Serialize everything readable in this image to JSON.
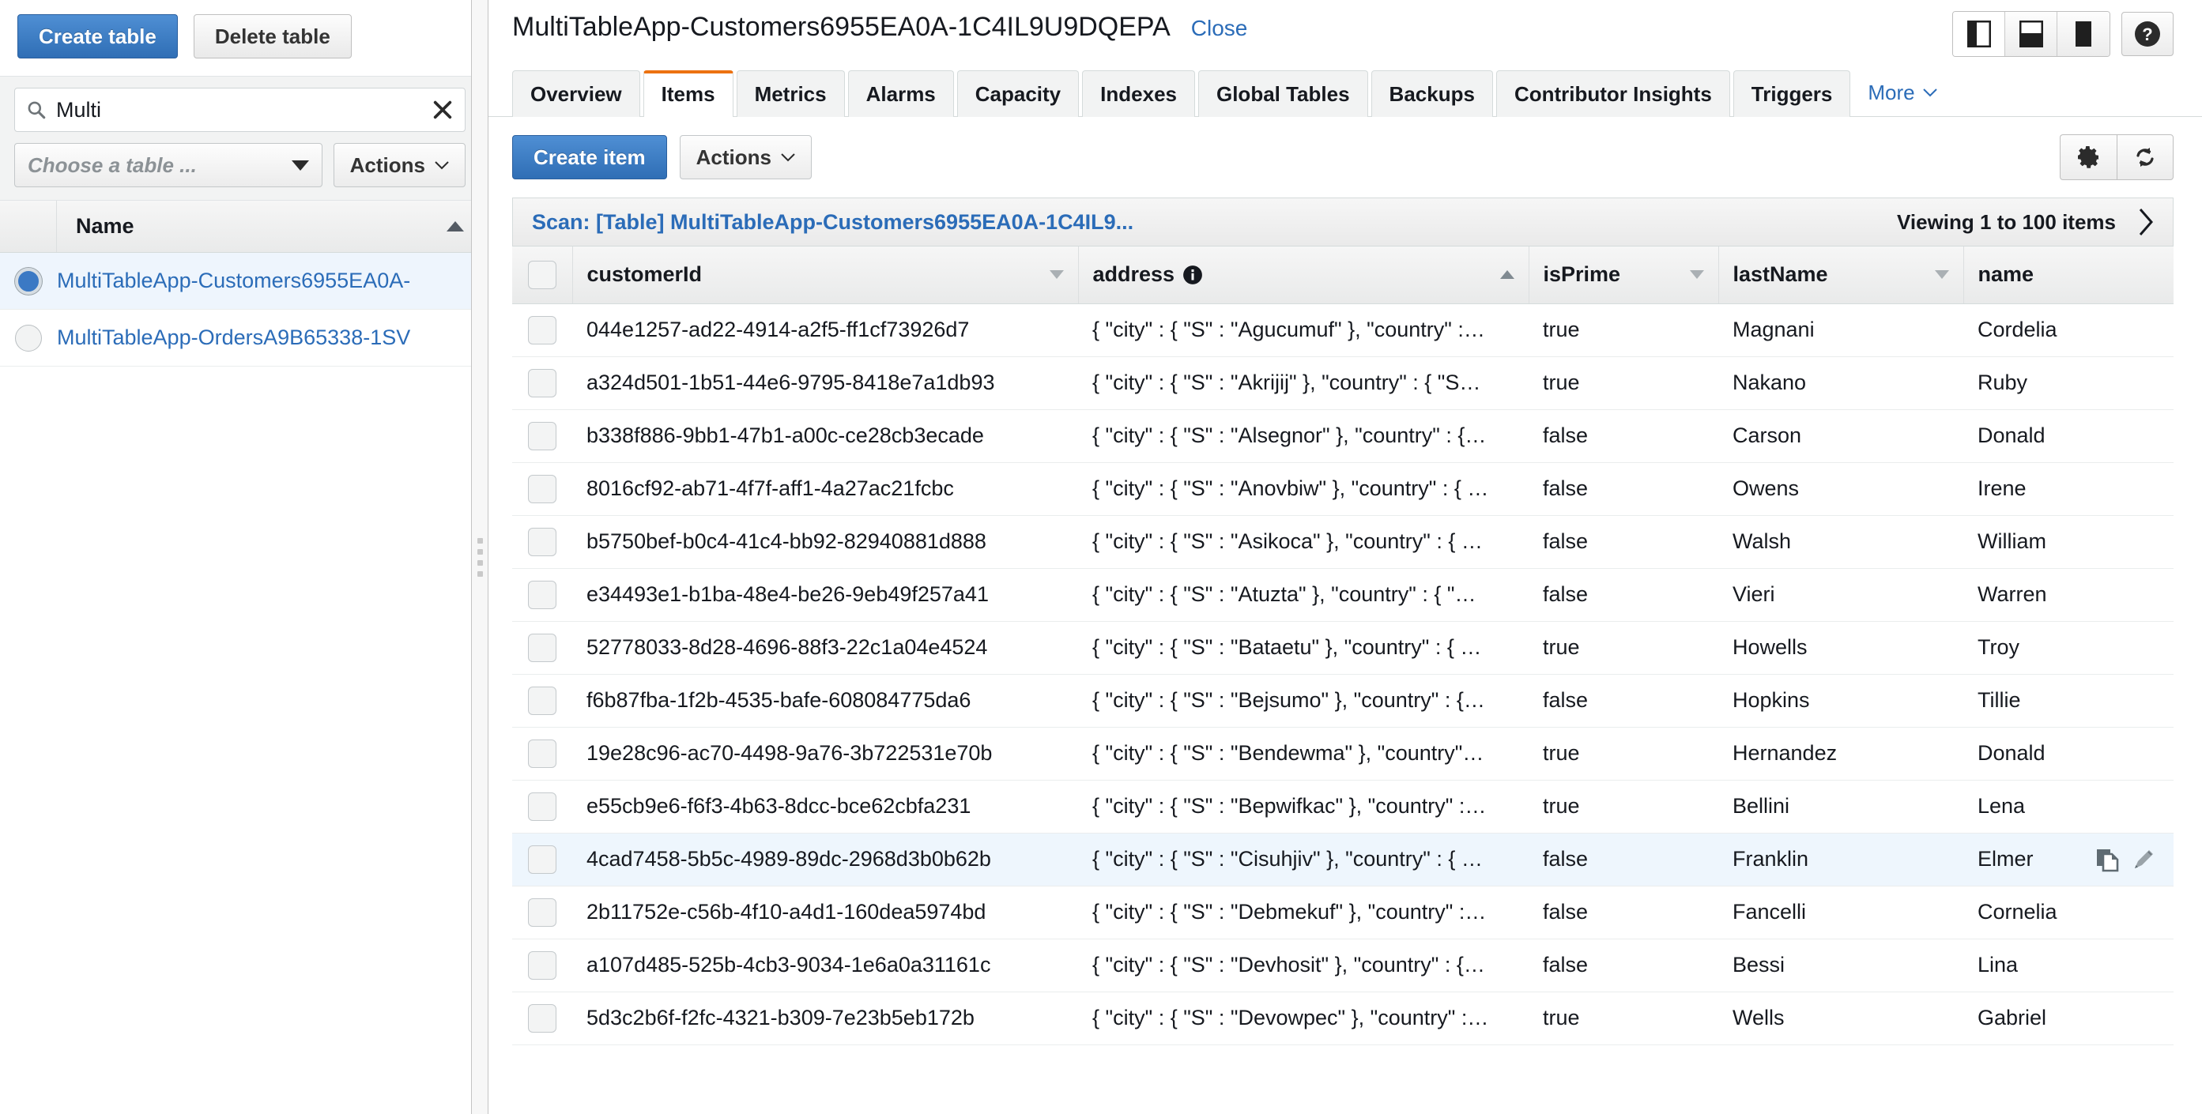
{
  "left_panel": {
    "create_table_label": "Create table",
    "delete_table_label": "Delete table",
    "search": {
      "value": "Multi",
      "icon": "search-icon",
      "clear_icon": "close-icon"
    },
    "table_select_placeholder": "Choose a table ...",
    "actions_label": "Actions",
    "list_header": "Name",
    "tables": [
      {
        "name": "MultiTableApp-Customers6955EA0A-",
        "selected": true
      },
      {
        "name": "MultiTableApp-OrdersA9B65338-1SV",
        "selected": false
      }
    ]
  },
  "header": {
    "title": "MultiTableApp-Customers6955EA0A-1C4IL9U9DQEPA",
    "close_label": "Close",
    "layout_icons": [
      "panel-left-icon",
      "panel-bottom-icon",
      "panel-none-icon"
    ],
    "help_icon": "help-icon"
  },
  "tabs": [
    {
      "label": "Overview",
      "active": false
    },
    {
      "label": "Items",
      "active": true
    },
    {
      "label": "Metrics",
      "active": false
    },
    {
      "label": "Alarms",
      "active": false
    },
    {
      "label": "Capacity",
      "active": false
    },
    {
      "label": "Indexes",
      "active": false
    },
    {
      "label": "Global Tables",
      "active": false
    },
    {
      "label": "Backups",
      "active": false
    },
    {
      "label": "Contributor Insights",
      "active": false
    },
    {
      "label": "Triggers",
      "active": false
    }
  ],
  "tab_more_label": "More",
  "action_bar": {
    "create_item_label": "Create item",
    "actions_label": "Actions",
    "settings_icon": "gear-icon",
    "refresh_icon": "refresh-icon"
  },
  "scan_bar": {
    "label": "Scan: [Table] MultiTableApp-Customers6955EA0A-1C4IL9...",
    "viewing": "Viewing 1 to 100 items",
    "next_icon": "chevron-right-icon"
  },
  "items_table": {
    "columns": [
      {
        "label": "customerId",
        "sort": "none",
        "info": false
      },
      {
        "label": "address",
        "sort": "asc",
        "info": true
      },
      {
        "label": "isPrime",
        "sort": "none",
        "info": false
      },
      {
        "label": "lastName",
        "sort": "none",
        "info": false
      },
      {
        "label": "name",
        "sort": "none",
        "info": false
      }
    ],
    "rows": [
      {
        "customerId": "044e1257-ad22-4914-a2f5-ff1cf73926d7",
        "address": "{ \"city\" : { \"S\" : \"Agucumuf\" }, \"country\" :…",
        "isPrime": "true",
        "lastName": "Magnani",
        "name": "Cordelia",
        "hovered": false
      },
      {
        "customerId": "a324d501-1b51-44e6-9795-8418e7a1db93",
        "address": "{ \"city\" : { \"S\" : \"Akrijij\" }, \"country\" : { \"S…",
        "isPrime": "true",
        "lastName": "Nakano",
        "name": "Ruby",
        "hovered": false
      },
      {
        "customerId": "b338f886-9bb1-47b1-a00c-ce28cb3ecade",
        "address": "{ \"city\" : { \"S\" : \"Alsegnor\" }, \"country\" : {…",
        "isPrime": "false",
        "lastName": "Carson",
        "name": "Donald",
        "hovered": false
      },
      {
        "customerId": "8016cf92-ab71-4f7f-aff1-4a27ac21fcbc",
        "address": "{ \"city\" : { \"S\" : \"Anovbiw\" }, \"country\" : { …",
        "isPrime": "false",
        "lastName": "Owens",
        "name": "Irene",
        "hovered": false
      },
      {
        "customerId": "b5750bef-b0c4-41c4-bb92-82940881d888",
        "address": "{ \"city\" : { \"S\" : \"Asikoca\" }, \"country\" : { …",
        "isPrime": "false",
        "lastName": "Walsh",
        "name": "William",
        "hovered": false
      },
      {
        "customerId": "e34493e1-b1ba-48e4-be26-9eb49f257a41",
        "address": "{ \"city\" : { \"S\" : \"Atuzta\" }, \"country\" : { \"…",
        "isPrime": "false",
        "lastName": "Vieri",
        "name": "Warren",
        "hovered": false
      },
      {
        "customerId": "52778033-8d28-4696-88f3-22c1a04e4524",
        "address": "{ \"city\" : { \"S\" : \"Bataetu\" }, \"country\" : { …",
        "isPrime": "true",
        "lastName": "Howells",
        "name": "Troy",
        "hovered": false
      },
      {
        "customerId": "f6b87fba-1f2b-4535-bafe-608084775da6",
        "address": "{ \"city\" : { \"S\" : \"Bejsumo\" }, \"country\" : {…",
        "isPrime": "false",
        "lastName": "Hopkins",
        "name": "Tillie",
        "hovered": false
      },
      {
        "customerId": "19e28c96-ac70-4498-9a76-3b722531e70b",
        "address": "{ \"city\" : { \"S\" : \"Bendewma\" }, \"country\"…",
        "isPrime": "true",
        "lastName": "Hernandez",
        "name": "Donald",
        "hovered": false
      },
      {
        "customerId": "e55cb9e6-f6f3-4b63-8dcc-bce62cbfa231",
        "address": "{ \"city\" : { \"S\" : \"Bepwifkac\" }, \"country\" :…",
        "isPrime": "true",
        "lastName": "Bellini",
        "name": "Lena",
        "hovered": false
      },
      {
        "customerId": "4cad7458-5b5c-4989-89dc-2968d3b0b62b",
        "address": "{ \"city\" : { \"S\" : \"Cisuhjiv\" }, \"country\" : { …",
        "isPrime": "false",
        "lastName": "Franklin",
        "name": "Elmer",
        "hovered": true
      },
      {
        "customerId": "2b11752e-c56b-4f10-a4d1-160dea5974bd",
        "address": "{ \"city\" : { \"S\" : \"Debmekuf\" }, \"country\" :…",
        "isPrime": "false",
        "lastName": "Fancelli",
        "name": "Cornelia",
        "hovered": false
      },
      {
        "customerId": "a107d485-525b-4cb3-9034-1e6a0a31161c",
        "address": "{ \"city\" : { \"S\" : \"Devhosit\" }, \"country\" : {…",
        "isPrime": "false",
        "lastName": "Bessi",
        "name": "Lina",
        "hovered": false
      },
      {
        "customerId": "5d3c2b6f-f2fc-4321-b309-7e23b5eb172b",
        "address": "{ \"city\" : { \"S\" : \"Devowpec\" }, \"country\" :…",
        "isPrime": "true",
        "lastName": "Wells",
        "name": "Gabriel",
        "hovered": false
      }
    ],
    "row_action_icons": [
      "copy-icon",
      "edit-icon"
    ]
  },
  "colors": {
    "accent_orange": "#ec7211",
    "link_blue": "#2b6cb8",
    "primary_button": "#2f6eb5",
    "row_hover": "#eef6fd"
  }
}
